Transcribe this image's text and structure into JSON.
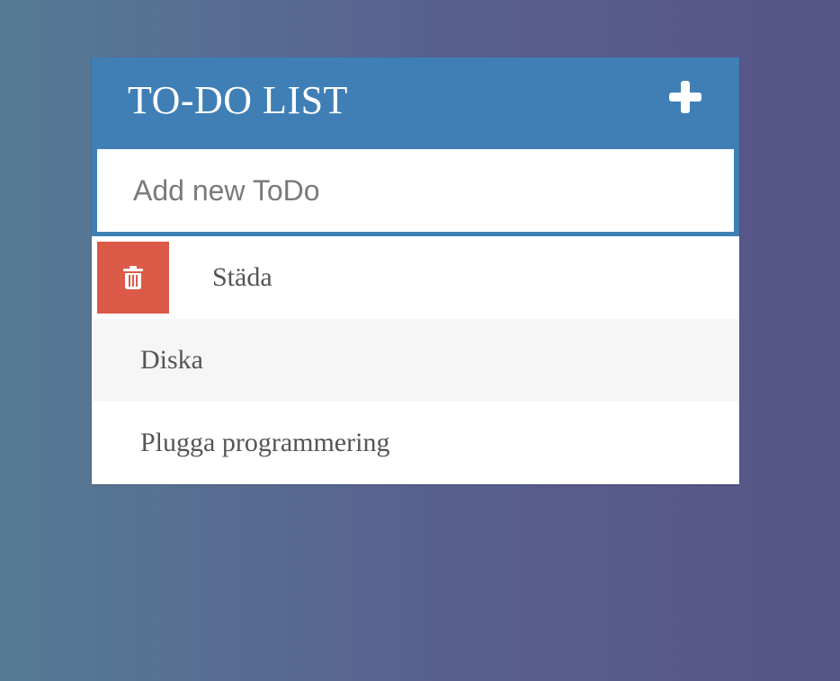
{
  "header": {
    "title": "TO-DO LIST",
    "add_icon": "plus-icon"
  },
  "input": {
    "placeholder": "Add new ToDo",
    "value": ""
  },
  "colors": {
    "header_background": "#3f7fb6",
    "delete_button": "#db5a48",
    "item_alt_background": "#f6f6f6",
    "text": "#555555"
  },
  "todos": [
    {
      "text": "Städa",
      "delete_icon": "trash-icon",
      "delete_visible": true
    },
    {
      "text": "Diska",
      "delete_icon": "trash-icon",
      "delete_visible": false
    },
    {
      "text": "Plugga programmering",
      "delete_icon": "trash-icon",
      "delete_visible": false
    }
  ]
}
